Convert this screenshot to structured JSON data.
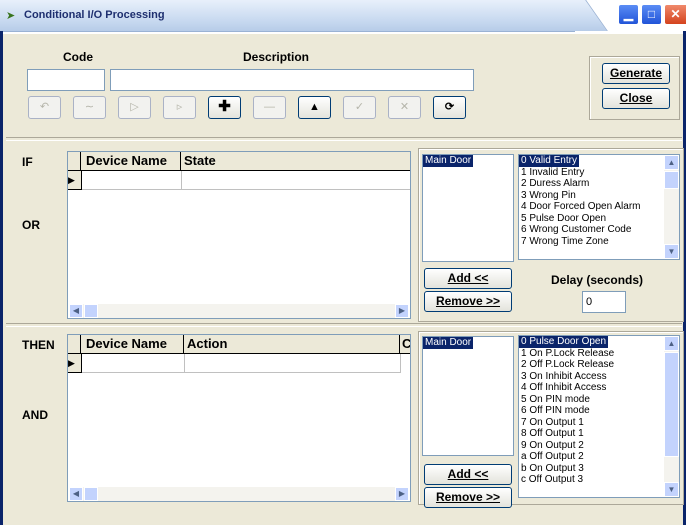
{
  "window": {
    "title": "Conditional I/O Processing"
  },
  "header": {
    "code_label": "Code",
    "description_label": "Description",
    "code_value": "",
    "description_value": ""
  },
  "actions": {
    "generate": "Generate",
    "close": "Close"
  },
  "if_section": {
    "if_label": "IF",
    "or_label": "OR",
    "columns": [
      "Device Name",
      "State"
    ],
    "devices": [
      "Main Door"
    ],
    "events": [
      "0 Valid Entry",
      "1 Invalid Entry",
      "2 Duress Alarm",
      "3 Wrong Pin",
      "4 Door Forced Open Alarm",
      "5 Pulse Door Open",
      "6 Wrong Customer Code",
      "7 Wrong Time Zone"
    ],
    "add_label": "Add <<",
    "remove_label": "Remove >>",
    "delay_label": "Delay (seconds)",
    "delay_value": "0"
  },
  "then_section": {
    "then_label": "THEN",
    "and_label": "AND",
    "columns": [
      "Device Name",
      "Action",
      "C"
    ],
    "devices": [
      "Main Door"
    ],
    "actions": [
      "0 Pulse Door Open",
      "1 On P.Lock Release",
      "2 Off P.Lock Release",
      "3 On Inhibit Access",
      "4 Off Inhibit Access",
      "5 On PIN mode",
      "6 Off PIN mode",
      "7 On Output 1",
      "8 Off Output 1",
      "9 On Output 2",
      "a Off Output 2",
      "b On Output 3",
      "c Off Output 3"
    ],
    "add_label": "Add <<",
    "remove_label": "Remove >>"
  }
}
